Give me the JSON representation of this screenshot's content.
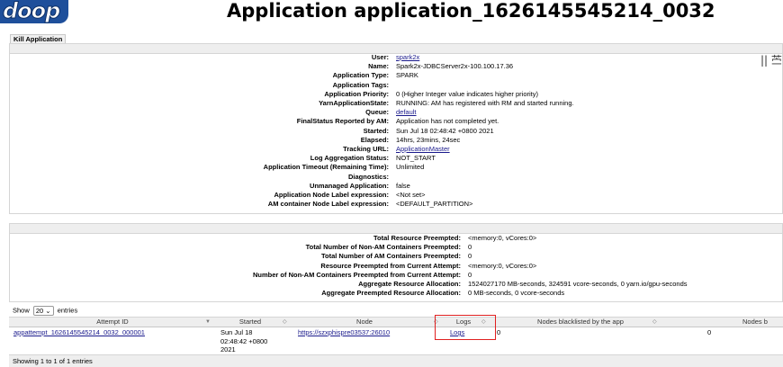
{
  "header": {
    "logo_text": "doop",
    "title": "Application application_1626145545214_0032",
    "side_glyph": "|| 苎"
  },
  "kill_button": "Kill Application",
  "app_info": [
    {
      "key": "User:",
      "value": "spark2x",
      "link": true
    },
    {
      "key": "Name:",
      "value": "Spark2x-JDBCServer2x-100.100.17.36",
      "link": false
    },
    {
      "key": "Application Type:",
      "value": "SPARK",
      "link": false
    },
    {
      "key": "Application Tags:",
      "value": "",
      "link": false
    },
    {
      "key": "Application Priority:",
      "value": "0 (Higher Integer value indicates higher priority)",
      "link": false
    },
    {
      "key": "YarnApplicationState:",
      "value": "RUNNING: AM has registered with RM and started running.",
      "link": false
    },
    {
      "key": "Queue:",
      "value": "default",
      "link": true
    },
    {
      "key": "FinalStatus Reported by AM:",
      "value": "Application has not completed yet.",
      "link": false
    },
    {
      "key": "Started:",
      "value": "Sun Jul 18 02:48:42 +0800 2021",
      "link": false
    },
    {
      "key": "Elapsed:",
      "value": "14hrs, 23mins, 24sec",
      "link": false
    },
    {
      "key": "Tracking URL:",
      "value": "ApplicationMaster",
      "link": true
    },
    {
      "key": "Log Aggregation Status:",
      "value": "NOT_START",
      "link": false
    },
    {
      "key": "Application Timeout (Remaining Time):",
      "value": "Unlimited",
      "link": false
    },
    {
      "key": "Diagnostics:",
      "value": "",
      "link": false
    },
    {
      "key": "Unmanaged Application:",
      "value": "false",
      "link": false
    },
    {
      "key": "Application Node Label expression:",
      "value": "<Not set>",
      "link": false
    },
    {
      "key": "AM container Node Label expression:",
      "value": "<DEFAULT_PARTITION>",
      "link": false
    }
  ],
  "metrics": [
    {
      "key": "Total Resource Preempted:",
      "value": "<memory:0, vCores:0>"
    },
    {
      "key": "Total Number of Non-AM Containers Preempted:",
      "value": "0"
    },
    {
      "key": "Total Number of AM Containers Preempted:",
      "value": "0"
    },
    {
      "key": "Resource Preempted from Current Attempt:",
      "value": "<memory:0, vCores:0>"
    },
    {
      "key": "Number of Non-AM Containers Preempted from Current Attempt:",
      "value": "0"
    },
    {
      "key": "Aggregate Resource Allocation:",
      "value": "1524027170 MB-seconds, 324591 vcore-seconds, 0 yarn.io/gpu-seconds"
    },
    {
      "key": "Aggregate Preempted Resource Allocation:",
      "value": "0 MB-seconds, 0 vcore-seconds"
    }
  ],
  "entries": {
    "show_label": "Show",
    "page_size": "20",
    "entries_label": "entries",
    "footer": "Showing 1 to 1 of 1 entries"
  },
  "attempts_table": {
    "headers": [
      "Attempt ID",
      "Started",
      "Node",
      "Logs",
      "Nodes blacklisted by the app",
      "Nodes b"
    ],
    "row": {
      "attempt_id": "appattempt_1626145545214_0032_000001",
      "started_line1": "Sun Jul 18",
      "started_line2": "02:48:42 +0800",
      "started_line3": "2021",
      "node": "https://szxphispre03537:26010",
      "logs": "Logs",
      "blacklisted": "0",
      "nodes_b": "0"
    }
  }
}
